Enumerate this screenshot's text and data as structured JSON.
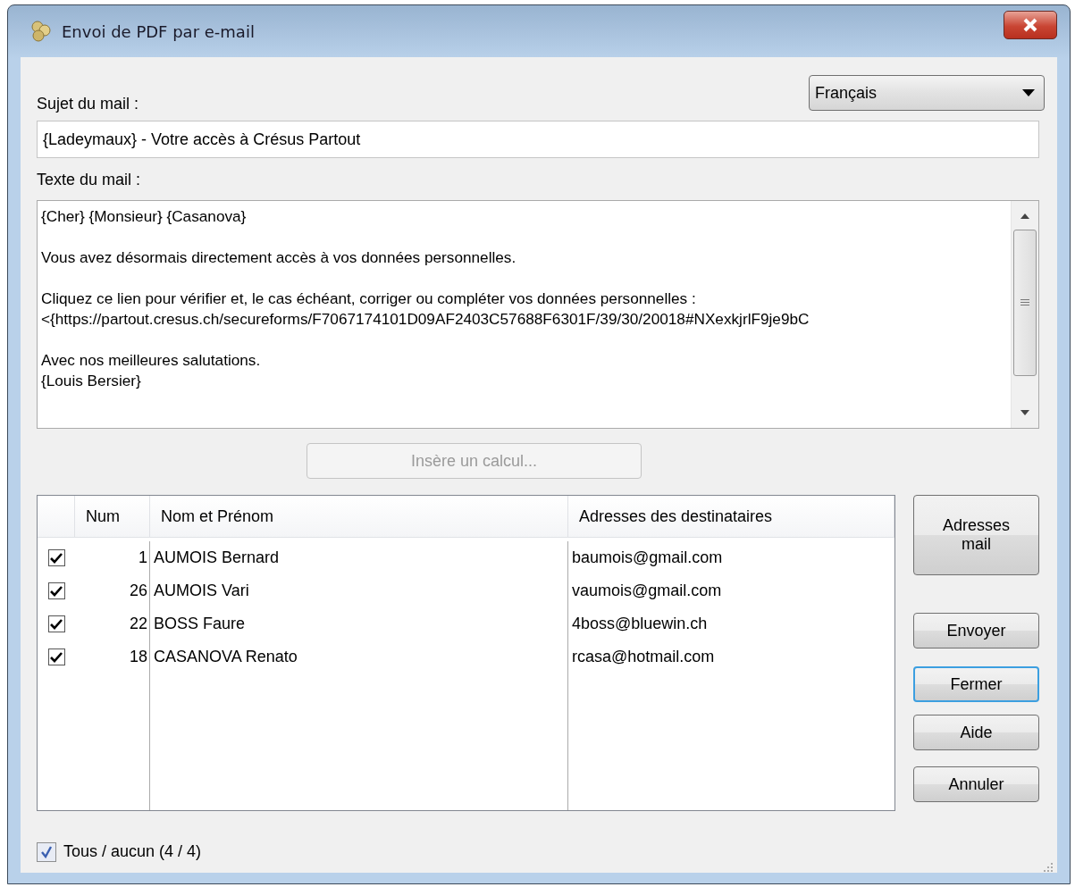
{
  "window": {
    "title": "Envoi de PDF par e-mail"
  },
  "language": {
    "value": "Français"
  },
  "subject": {
    "label": "Sujet du mail :",
    "value": "{Ladeymaux} - Votre accès à Crésus Partout"
  },
  "body": {
    "label": "Texte du mail :",
    "paragraphs": [
      {
        "lines": [
          "{Cher} {Monsieur} {Casanova}"
        ]
      },
      {
        "lines": [
          "Vous avez désormais directement accès à vos données personnelles."
        ]
      },
      {
        "lines": [
          "Cliquez ce lien pour vérifier et, le cas échéant, corriger ou compléter vos données personnelles :",
          "<{https://partout.cresus.ch/secureforms/F7067174101D09AF2403C57688F6301F/39/30/20018#NXexkjrlF9je9bC"
        ]
      },
      {
        "lines": [
          "Avec nos meilleures salutations.",
          "{Louis Bersier}"
        ]
      }
    ]
  },
  "insert_button": {
    "label": "Insère un calcul...",
    "disabled": true
  },
  "table": {
    "columns": [
      "Num",
      "Nom et Prénom",
      "Adresses des destinataires"
    ],
    "rows": [
      {
        "checked": true,
        "num": "1",
        "name": "AUMOIS Bernard",
        "email": "baumois@gmail.com"
      },
      {
        "checked": true,
        "num": "26",
        "name": "AUMOIS Vari",
        "email": "vaumois@gmail.com"
      },
      {
        "checked": true,
        "num": "22",
        "name": "BOSS Faure",
        "email": "4boss@bluewin.ch"
      },
      {
        "checked": true,
        "num": "18",
        "name": "CASANOVA Renato",
        "email": "rcasa@hotmail.com"
      }
    ]
  },
  "side_buttons": [
    {
      "label": "Adresses mail",
      "focused": false,
      "kind": "tall"
    },
    {
      "label": "Envoyer",
      "focused": false,
      "kind": "normal"
    },
    {
      "label": "Fermer",
      "focused": true,
      "kind": "normal"
    },
    {
      "label": "Aide",
      "focused": false,
      "kind": "normal"
    },
    {
      "label": "Annuler",
      "focused": false,
      "kind": "normal"
    }
  ],
  "select_all": {
    "label": "Tous / aucun (4 / 4)",
    "checked": true
  }
}
